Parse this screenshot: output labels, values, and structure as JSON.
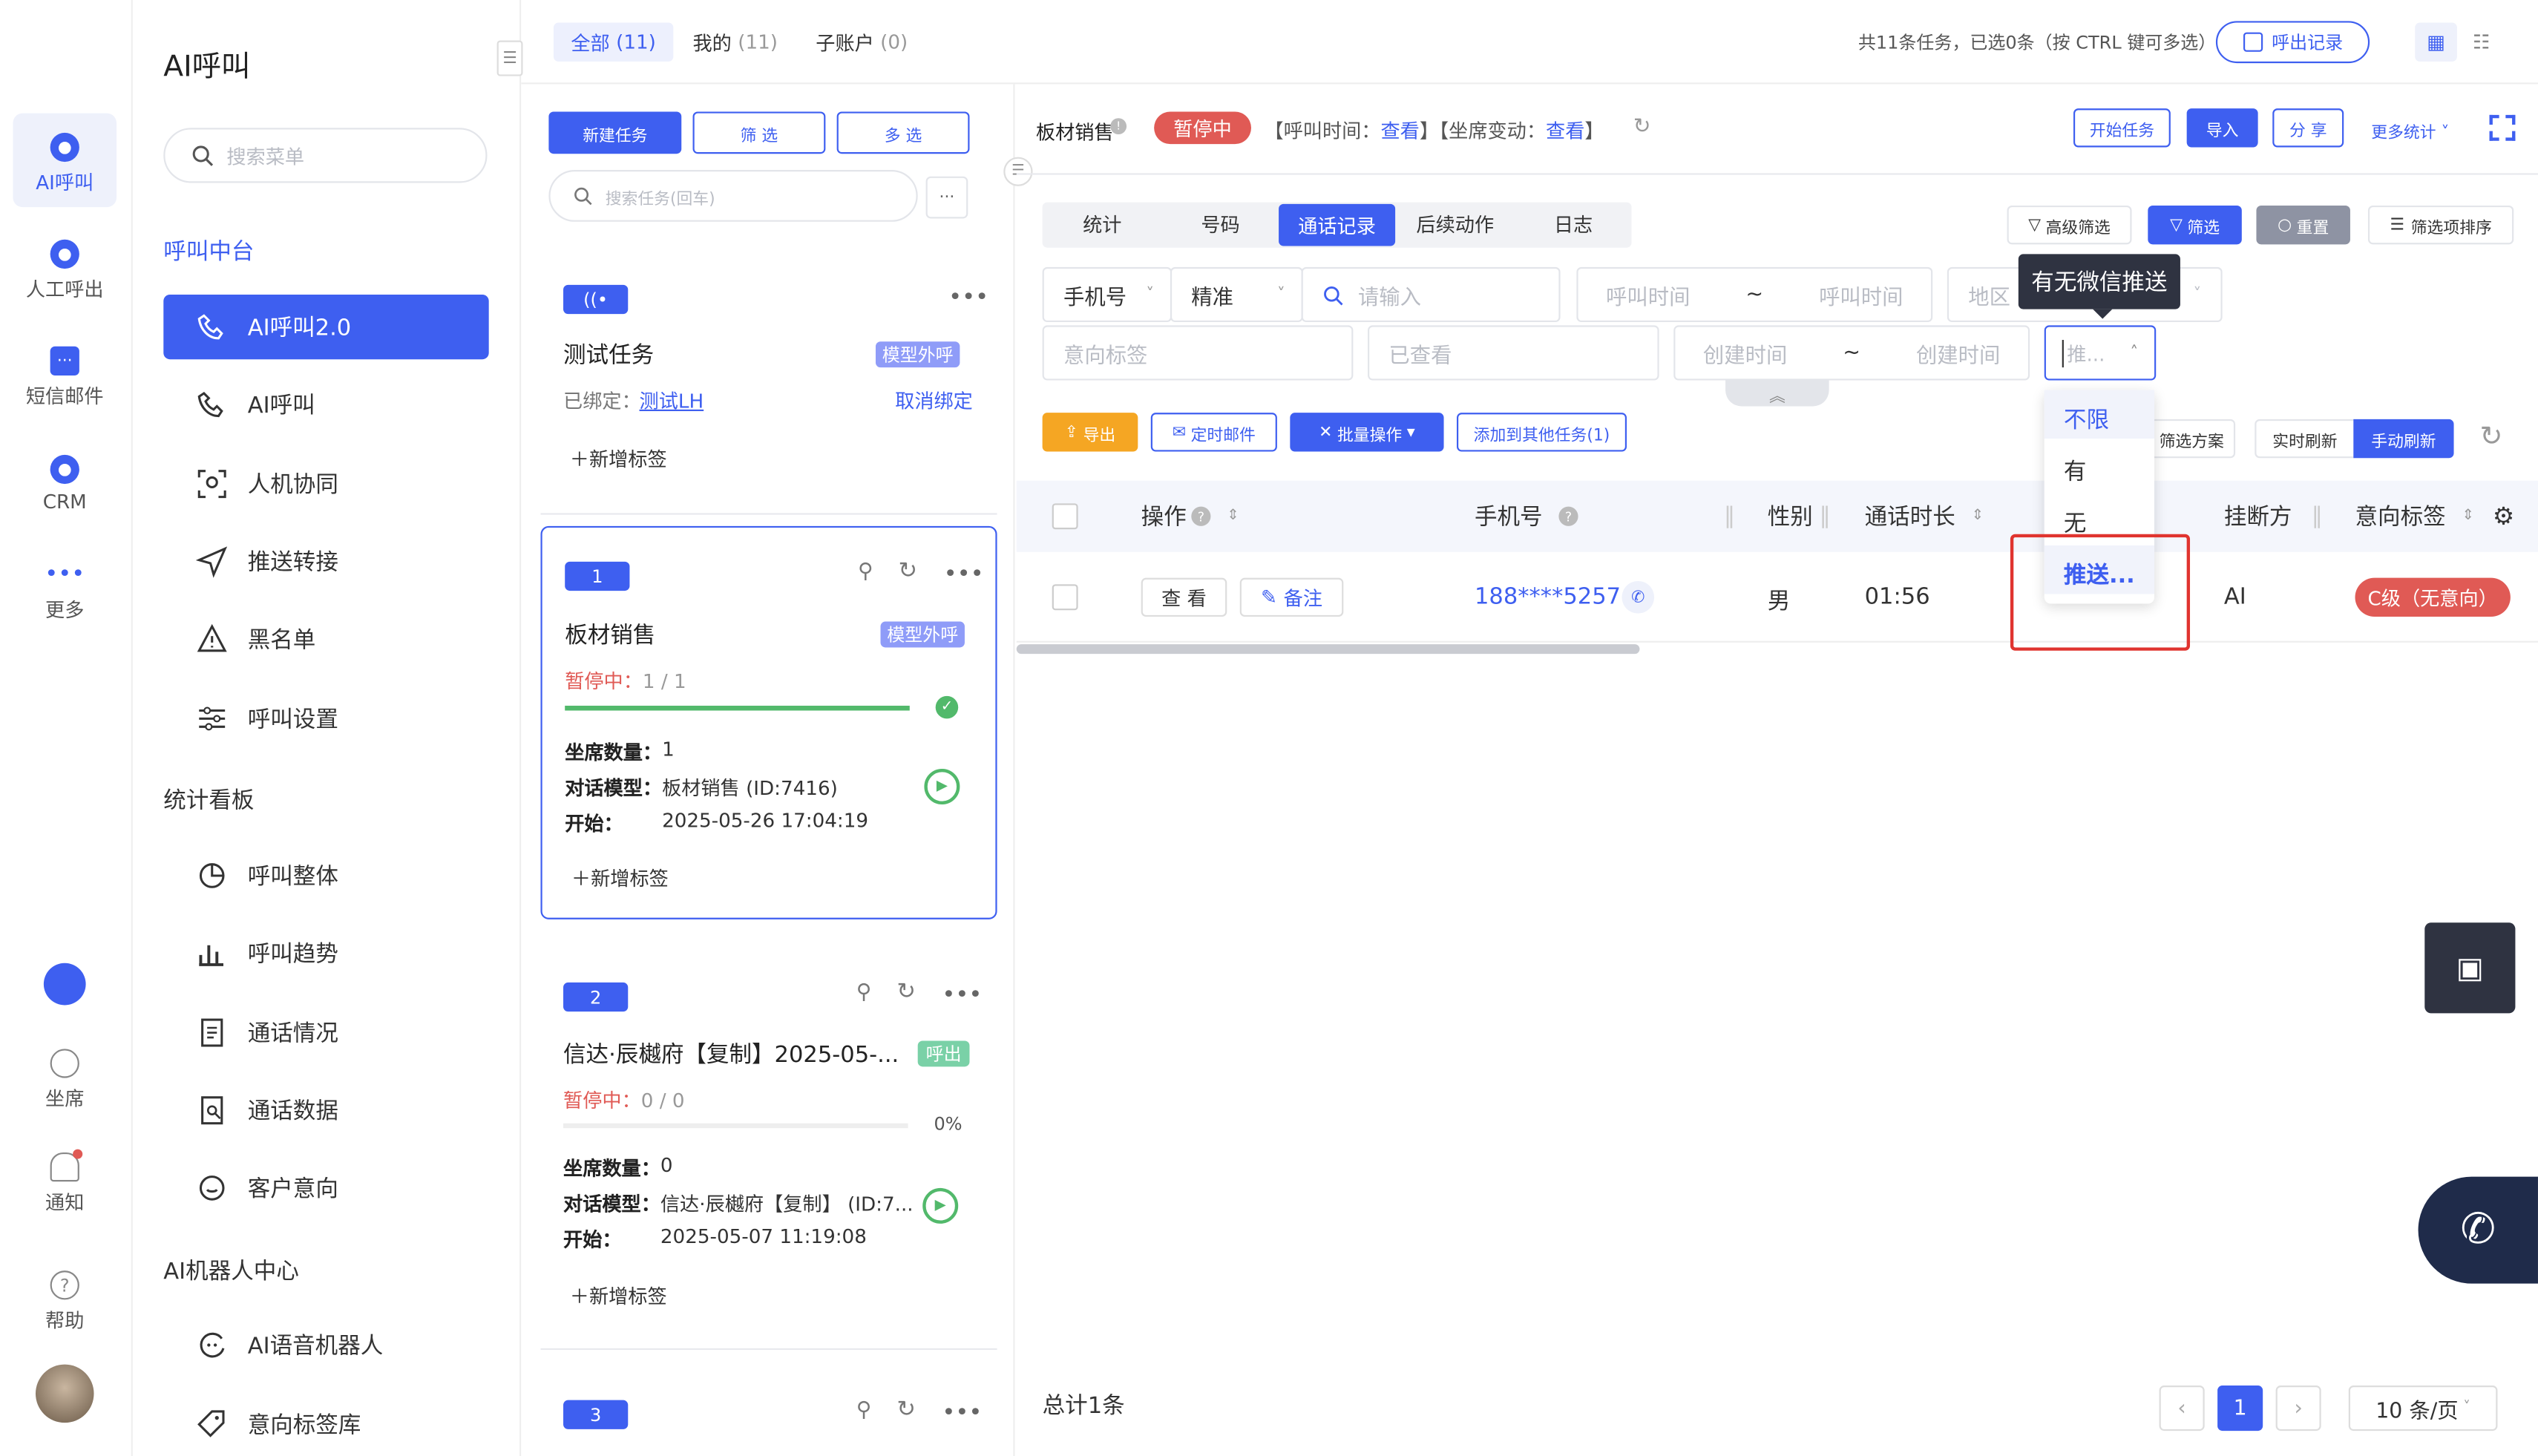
{
  "rail": {
    "items": [
      {
        "label": "AI呼叫"
      },
      {
        "label": "人工呼出"
      },
      {
        "label": "短信邮件"
      },
      {
        "label": "CRM"
      },
      {
        "label": "更多"
      }
    ],
    "bottom": [
      {
        "label": "坐席"
      },
      {
        "label": "通知"
      },
      {
        "label": "帮助"
      }
    ]
  },
  "menu": {
    "title": "AI呼叫",
    "search_placeholder": "搜索菜单",
    "sections": [
      {
        "title": "呼叫中台",
        "items": [
          "AI呼叫2.0",
          "AI呼叫",
          "人机协同",
          "推送转接",
          "黑名单",
          "呼叫设置"
        ]
      },
      {
        "title": "统计看板",
        "items": [
          "呼叫整体",
          "呼叫趋势",
          "通话情况",
          "通话数据",
          "客户意向"
        ]
      },
      {
        "title": "AI机器人中心",
        "items": [
          "AI语音机器人",
          "意向标签库"
        ]
      }
    ]
  },
  "topbar": {
    "tabs": [
      {
        "label": "全部",
        "count": "(11)"
      },
      {
        "label": "我的",
        "count": "(11)"
      },
      {
        "label": "子账户",
        "count": "(0)"
      }
    ],
    "summary": "共11条任务，已选0条（按 CTRL 键可多选）",
    "call_record_btn": "呼出记录"
  },
  "tasklist": {
    "new_btn": "新建任务",
    "filter_btn": "筛 选",
    "multi_btn": "多 选",
    "search_placeholder": "搜索任务(回车)",
    "more": "···",
    "cards": [
      {
        "title": "测试任务",
        "type": "模型外呼",
        "bound_label": "已绑定：",
        "bound_value": "测试LH",
        "unbind": "取消绑定",
        "add_tag": "新增标签"
      },
      {
        "badge": "1",
        "title": "板材销售",
        "type": "模型外呼",
        "status": "暂停中：",
        "progress_text": "1 / 1",
        "progress": 1.0,
        "seats_label": "坐席数量：",
        "seats": "1",
        "model_label": "对话模型：",
        "model": "板材销售 (ID:7416)",
        "start_label": "开始：",
        "start": "2025-05-26 17:04:19",
        "add_tag": "新增标签"
      },
      {
        "badge": "2",
        "title": "信达·辰樾府【复制】2025-05-...",
        "type": "呼出",
        "status": "暂停中：",
        "progress_text": "0 / 0",
        "percent": "0%",
        "progress": 0.0,
        "seats_label": "坐席数量：",
        "seats": "0",
        "model_label": "对话模型：",
        "model": "信达·辰樾府【复制】 (ID:7...",
        "start_label": "开始：",
        "start": "2025-05-07 11:19:08",
        "add_tag": "新增标签"
      },
      {
        "badge": "3"
      }
    ]
  },
  "main": {
    "task_name": "板材销售",
    "status": "暂停中",
    "call_time_label": "【呼叫时间：",
    "call_time_link": "查看",
    "seat_change_label": "】【坐席变动：",
    "seat_change_link": "查看",
    "bracket_end": "】",
    "buttons": {
      "start": "开始任务",
      "import": "导入",
      "share": "分 享",
      "more_stats": "更多统计"
    },
    "tabs": [
      "统计",
      "号码",
      "通话记录",
      "后续动作",
      "日志"
    ],
    "filter_btns": {
      "advanced": "高级筛选",
      "filter": "筛选",
      "reset": "重置",
      "sort": "筛选项排序"
    },
    "filters": {
      "phone_type": "手机号",
      "match": "精准",
      "input_ph": "请输入",
      "call_time_start": "呼叫时间",
      "call_time_end": "呼叫时间",
      "tilde": "~",
      "region": "地区",
      "intent": "意向标签",
      "viewed": "已查看",
      "create_start": "创建时间",
      "create_end": "创建时间",
      "push_value": "推..."
    },
    "tooltip": "有无微信推送",
    "dropdown": [
      "不限",
      "有",
      "无",
      "推送..."
    ],
    "actions": {
      "export": "导出",
      "schedule_mail": "定时邮件",
      "batch": "批量操作",
      "add_other": "添加到其他任务(1)",
      "plan": "筛选方案",
      "realtime": "实时刷新",
      "manual": "手动刷新"
    },
    "table": {
      "headers": [
        "操作",
        "手机号",
        "性别",
        "通话时长",
        "挂断方",
        "意向标签"
      ],
      "rows": [
        {
          "view": "查 看",
          "note": "备注",
          "phone": "188****5257",
          "gender": "男",
          "duration": "01:56",
          "hangup": "AI",
          "intent": "C级（无意向）"
        }
      ]
    },
    "footer": {
      "total": "总计1条",
      "page": "1",
      "page_size": "10 条/页"
    }
  },
  "colors": {
    "primary": "#3e5ff0",
    "danger": "#e05a55",
    "success": "#52b96b",
    "orange": "#f5a623"
  }
}
